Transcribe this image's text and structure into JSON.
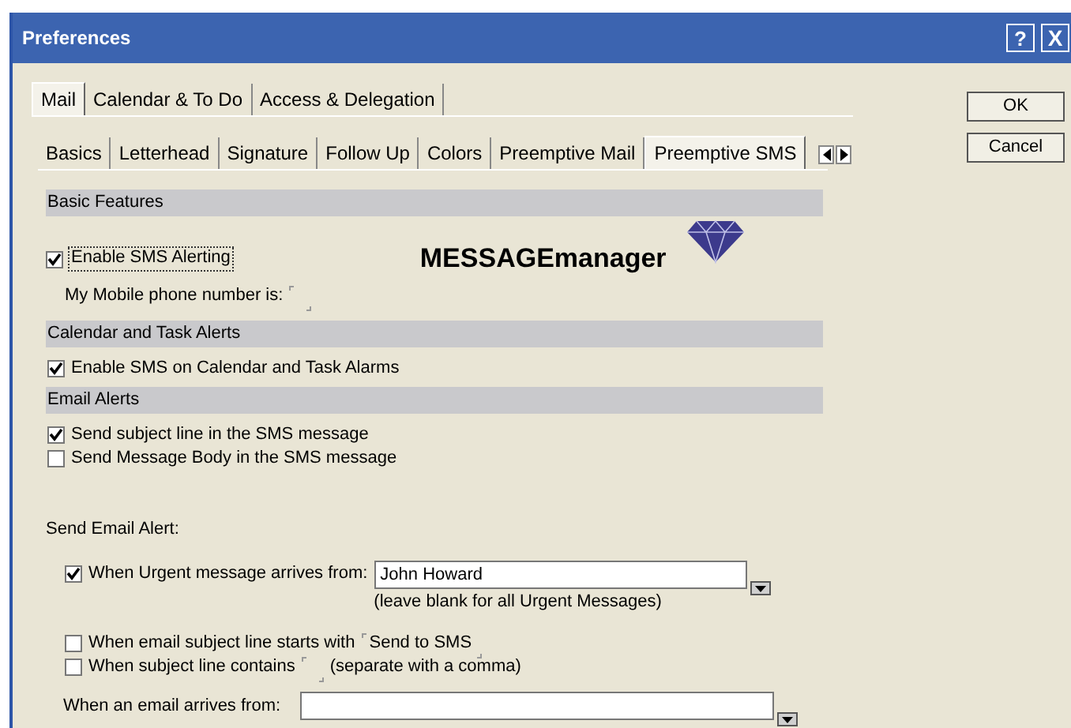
{
  "window": {
    "title": "Preferences",
    "controls": [
      {
        "kind": "help",
        "label": "?"
      },
      {
        "kind": "close",
        "label": "X"
      }
    ]
  },
  "tabs": [
    {
      "label": "Mail",
      "selected": true
    },
    {
      "label": "Calendar & To Do",
      "selected": false
    },
    {
      "label": "Access & Delegation",
      "selected": false
    }
  ],
  "subtabs": [
    {
      "label": "Basics",
      "selected": false
    },
    {
      "label": "Letterhead",
      "selected": false
    },
    {
      "label": "Signature",
      "selected": false
    },
    {
      "label": "Follow Up",
      "selected": false
    },
    {
      "label": "Colors",
      "selected": false
    },
    {
      "label": "Preemptive Mail",
      "selected": false
    },
    {
      "label": "Preemptive SMS",
      "selected": true
    }
  ],
  "buttons": [
    "OK",
    "Cancel"
  ],
  "sections": [
    {
      "title": "Basic Features",
      "items": [
        {
          "kind": "logo",
          "label": "Enable SMS Alerting",
          "checked": true,
          "focused": true,
          "logo": "MESSAGEmanager"
        },
        {
          "kind": "inline",
          "label": "My Mobile phone number is:"
        }
      ]
    },
    {
      "title": "Calendar and Task Alerts",
      "items": [
        {
          "kind": "checkbox",
          "label": "Enable SMS on Calendar and Task Alarms",
          "checked": true
        }
      ]
    },
    {
      "title": "Email Alerts",
      "items": [
        {
          "kind": "checkbox",
          "label": "Send subject line in the SMS message",
          "checked": true
        },
        {
          "kind": "checkbox",
          "label": "Send Message Body in the SMS message",
          "checked": false
        },
        {
          "kind": "heading",
          "label": "Send Email Alert:"
        },
        {
          "kind": "combo_check",
          "label": "When Urgent message arrives from:",
          "checked": true,
          "value": "John Howard",
          "note": "(leave blank for all Urgent Messages)"
        },
        {
          "kind": "inline_check",
          "label": "When email subject line starts with",
          "checked": false,
          "value": "Send to SMS"
        },
        {
          "kind": "inline_check",
          "label": "When subject line contains",
          "checked": false,
          "suffix": "(separate with a comma)"
        },
        {
          "kind": "combo",
          "label": "When an email arrives from:"
        }
      ]
    }
  ]
}
